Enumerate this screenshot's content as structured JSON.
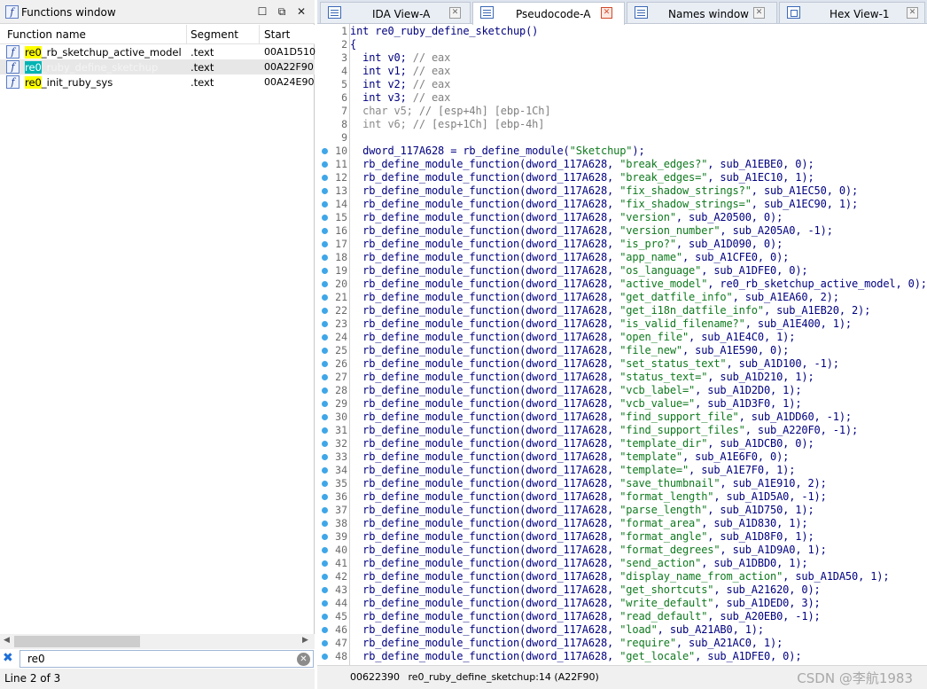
{
  "functions_window": {
    "title": "Functions window",
    "columns": [
      "Function name",
      "Segment",
      "Start"
    ],
    "rows": [
      {
        "match": "re0",
        "rest": "_rb_sketchup_active_model",
        "segment": ".text",
        "start": "00A1D510"
      },
      {
        "match": "re0",
        "rest": "_ruby_define_sketchup",
        "segment": ".text",
        "start": "00A22F90"
      },
      {
        "match": "re0",
        "rest": "_init_ruby_sys",
        "segment": ".text",
        "start": "00A24E90"
      }
    ],
    "filter_value": "re0",
    "status": "Line 2 of 3"
  },
  "tabs": [
    {
      "label": "IDA View-A"
    },
    {
      "label": "Pseudocode-A"
    },
    {
      "label": "Names window"
    },
    {
      "label": "Hex View-1"
    }
  ],
  "code": {
    "header": [
      {
        "n": "1",
        "text": "int re0_ruby_define_sketchup()"
      },
      {
        "n": "2",
        "text": "{"
      },
      {
        "n": "3",
        "text": "  int v0; // eax"
      },
      {
        "n": "4",
        "text": "  int v1; // eax"
      },
      {
        "n": "5",
        "text": "  int v2; // eax"
      },
      {
        "n": "6",
        "text": "  int v3; // eax"
      },
      {
        "n": "7",
        "text": "  char v5; // [esp+4h] [ebp-1Ch]"
      },
      {
        "n": "8",
        "text": "  int v6; // [esp+1Ch] [ebp-4h]"
      },
      {
        "n": "9",
        "text": ""
      },
      {
        "n": "10",
        "text": "  dword_117A628 = rb_define_module(\"Sketchup\");"
      }
    ],
    "calls": [
      {
        "n": "11",
        "name": "break_edges?",
        "sub": "sub_A1EBE0",
        "argc": "0"
      },
      {
        "n": "12",
        "name": "break_edges=",
        "sub": "sub_A1EC10",
        "argc": "1"
      },
      {
        "n": "13",
        "name": "fix_shadow_strings?",
        "sub": "sub_A1EC50",
        "argc": "0"
      },
      {
        "n": "14",
        "name": "fix_shadow_strings=",
        "sub": "sub_A1EC90",
        "argc": "1"
      },
      {
        "n": "15",
        "name": "version",
        "sub": "sub_A20500",
        "argc": "0"
      },
      {
        "n": "16",
        "name": "version_number",
        "sub": "sub_A205A0",
        "argc": "-1"
      },
      {
        "n": "17",
        "name": "is_pro?",
        "sub": "sub_A1D090",
        "argc": "0"
      },
      {
        "n": "18",
        "name": "app_name",
        "sub": "sub_A1CFE0",
        "argc": "0"
      },
      {
        "n": "19",
        "name": "os_language",
        "sub": "sub_A1DFE0",
        "argc": "0"
      },
      {
        "n": "20",
        "name": "active_model",
        "sub": "re0_rb_sketchup_active_model",
        "argc": "0"
      },
      {
        "n": "21",
        "name": "get_datfile_info",
        "sub": "sub_A1EA60",
        "argc": "2"
      },
      {
        "n": "22",
        "name": "get_i18n_datfile_info",
        "sub": "sub_A1EB20",
        "argc": "2"
      },
      {
        "n": "23",
        "name": "is_valid_filename?",
        "sub": "sub_A1E400",
        "argc": "1"
      },
      {
        "n": "24",
        "name": "open_file",
        "sub": "sub_A1E4C0",
        "argc": "1"
      },
      {
        "n": "25",
        "name": "file_new",
        "sub": "sub_A1E590",
        "argc": "0"
      },
      {
        "n": "26",
        "name": "set_status_text",
        "sub": "sub_A1D100",
        "argc": "-1"
      },
      {
        "n": "27",
        "name": "status_text=",
        "sub": "sub_A1D210",
        "argc": "1"
      },
      {
        "n": "28",
        "name": "vcb_label=",
        "sub": "sub_A1D2D0",
        "argc": "1"
      },
      {
        "n": "29",
        "name": "vcb_value=",
        "sub": "sub_A1D3F0",
        "argc": "1"
      },
      {
        "n": "30",
        "name": "find_support_file",
        "sub": "sub_A1DD60",
        "argc": "-1"
      },
      {
        "n": "31",
        "name": "find_support_files",
        "sub": "sub_A220F0",
        "argc": "-1"
      },
      {
        "n": "32",
        "name": "template_dir",
        "sub": "sub_A1DCB0",
        "argc": "0"
      },
      {
        "n": "33",
        "name": "template",
        "sub": "sub_A1E6F0",
        "argc": "0"
      },
      {
        "n": "34",
        "name": "template=",
        "sub": "sub_A1E7F0",
        "argc": "1"
      },
      {
        "n": "35",
        "name": "save_thumbnail",
        "sub": "sub_A1E910",
        "argc": "2"
      },
      {
        "n": "36",
        "name": "format_length",
        "sub": "sub_A1D5A0",
        "argc": "-1"
      },
      {
        "n": "37",
        "name": "parse_length",
        "sub": "sub_A1D750",
        "argc": "1"
      },
      {
        "n": "38",
        "name": "format_area",
        "sub": "sub_A1D830",
        "argc": "1"
      },
      {
        "n": "39",
        "name": "format_angle",
        "sub": "sub_A1D8F0",
        "argc": "1"
      },
      {
        "n": "40",
        "name": "format_degrees",
        "sub": "sub_A1D9A0",
        "argc": "1"
      },
      {
        "n": "41",
        "name": "send_action",
        "sub": "sub_A1DBD0",
        "argc": "1"
      },
      {
        "n": "42",
        "name": "display_name_from_action",
        "sub": "sub_A1DA50",
        "argc": "1"
      },
      {
        "n": "43",
        "name": "get_shortcuts",
        "sub": "sub_A21620",
        "argc": "0"
      },
      {
        "n": "44",
        "name": "write_default",
        "sub": "sub_A1DED0",
        "argc": "3"
      },
      {
        "n": "45",
        "name": "read_default",
        "sub": "sub_A20EB0",
        "argc": "-1"
      },
      {
        "n": "46",
        "name": "load",
        "sub": "sub_A21AB0",
        "argc": "1"
      },
      {
        "n": "47",
        "name": "require",
        "sub": "sub_A21AC0",
        "argc": "1"
      },
      {
        "n": "48",
        "name": "get_locale",
        "sub": "sub_A1DFE0",
        "argc": "0"
      }
    ]
  },
  "status_bar": {
    "offset": "00622390",
    "location": "re0_ruby_define_sketchup:14 (A22F90)",
    "watermark": "CSDN @李航1983"
  }
}
